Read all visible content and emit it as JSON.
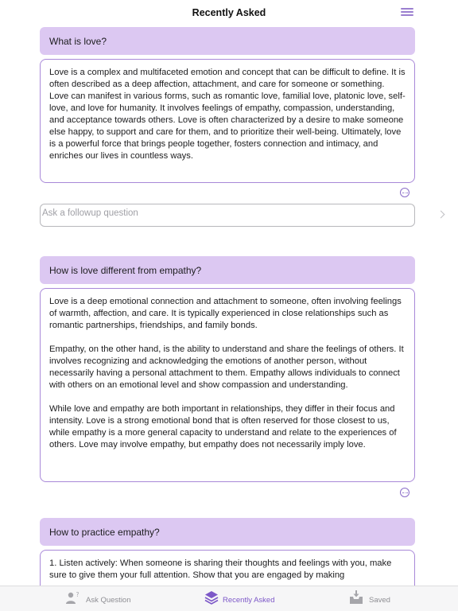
{
  "header": {
    "title": "Recently Asked"
  },
  "threads": [
    {
      "question": "What is love?",
      "answer": [
        "Love is a complex and multifaceted emotion and concept that can be difficult to define. It is often described as a deep affection, attachment, and care for someone or something. Love can manifest in various forms, such as romantic love, familial love, platonic love, self-love, and love for humanity. It involves feelings of empathy, compassion, understanding, and acceptance towards others. Love is often characterized by a desire to make someone else happy, to support and care for them, and to prioritize their well-being. Ultimately, love is a powerful force that brings people together, fosters connection and intimacy, and enriches our lives in countless ways."
      ]
    },
    {
      "question": "How is love different from empathy?",
      "answer": [
        "Love is a deep emotional connection and attachment to someone, often involving feelings of warmth, affection, and care. It is typically experienced in close relationships such as romantic partnerships, friendships, and family bonds.",
        "Empathy, on the other hand, is the ability to understand and share the feelings of others. It involves recognizing and acknowledging the emotions of another person, without necessarily having a personal attachment to them. Empathy allows individuals to connect with others on an emotional level and show compassion and understanding.",
        "While love and empathy are both important in relationships, they differ in their focus and intensity. Love is a strong emotional bond that is often reserved for those closest to us, while empathy is a more general capacity to understand and relate to the experiences of others. Love may involve empathy, but empathy does not necessarily imply love."
      ]
    },
    {
      "question": "How to practice empathy?",
      "answer": [
        "1. Listen actively: When someone is sharing their thoughts and feelings with you, make sure to give them your full attention. Show that you are engaged by making"
      ]
    }
  ],
  "followup": {
    "placeholder": "Ask a followup question",
    "value": ""
  },
  "tabbar": {
    "tabs": [
      {
        "label": "Ask Question",
        "icon": "person-question-icon",
        "active": false
      },
      {
        "label": "Recently Asked",
        "icon": "stack-icon",
        "active": true
      },
      {
        "label": "Saved",
        "icon": "tray-download-icon",
        "active": false
      }
    ]
  },
  "colors": {
    "accent": "#7d58c8",
    "question_bg": "#dcc8f2",
    "answer_border": "#a888d8"
  }
}
